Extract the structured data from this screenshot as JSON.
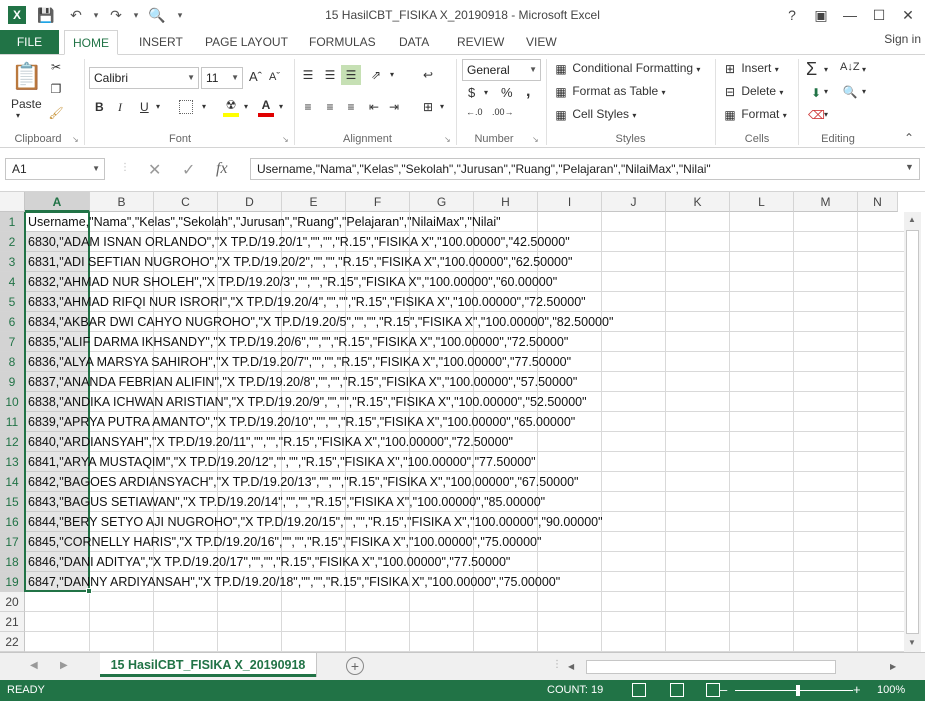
{
  "window": {
    "title": "15 HasilCBT_FISIKA X_20190918 - Microsoft Excel",
    "app_icon": "excel-x-icon",
    "help": "?",
    "controls": [
      "restore-ribbon-icon",
      "minimize-icon",
      "maximize-icon",
      "close-icon"
    ]
  },
  "ribbon_tabs": {
    "file": "FILE",
    "tabs": [
      "HOME",
      "INSERT",
      "PAGE LAYOUT",
      "FORMULAS",
      "DATA",
      "REVIEW",
      "VIEW"
    ],
    "active": "HOME",
    "signin": "Sign in"
  },
  "ribbon": {
    "clipboard": {
      "paste": "Paste",
      "label": "Clipboard"
    },
    "font": {
      "name": "Calibri",
      "size": "11",
      "label": "Font",
      "bold": "B",
      "italic": "I",
      "underline": "U"
    },
    "alignment": {
      "label": "Alignment"
    },
    "number": {
      "format": "General",
      "currency": "$",
      "percent": "%",
      "comma": ",",
      "label": "Number"
    },
    "styles": {
      "conditional": "Conditional Formatting",
      "format_table": "Format as Table",
      "cell_styles": "Cell Styles",
      "label": "Styles"
    },
    "cells": {
      "insert": "Insert",
      "delete": "Delete",
      "format": "Format",
      "label": "Cells"
    },
    "editing": {
      "label": "Editing"
    }
  },
  "formula_bar": {
    "name_box": "A1",
    "fx": "fx",
    "content": "Username,\"Nama\",\"Kelas\",\"Sekolah\",\"Jurusan\",\"Ruang\",\"Pelajaran\",\"NilaiMax\",\"Nilai\""
  },
  "grid": {
    "columns": [
      "A",
      "B",
      "C",
      "D",
      "E",
      "F",
      "G",
      "H",
      "I",
      "J",
      "K",
      "L",
      "M",
      "N"
    ],
    "selected_column": "A",
    "row_numbers": [
      "1",
      "2",
      "3",
      "4",
      "5",
      "6",
      "7",
      "8",
      "9",
      "10",
      "11",
      "12",
      "13",
      "14",
      "15",
      "16",
      "17",
      "18",
      "19",
      "20",
      "21",
      "22"
    ],
    "rows": [
      "Username,\"Nama\",\"Kelas\",\"Sekolah\",\"Jurusan\",\"Ruang\",\"Pelajaran\",\"NilaiMax\",\"Nilai\"",
      "6830,\"ADAM ISNAN ORLANDO\",\"X TP.D/19.20/1\",\"\",\"\",\"R.15\",\"FISIKA X\",\"100.00000\",\"42.50000\"",
      "6831,\"ADI SEFTIAN NUGROHO\",\"X TP.D/19.20/2\",\"\",\"\",\"R.15\",\"FISIKA X\",\"100.00000\",\"62.50000\"",
      "6832,\"AHMAD NUR SHOLEH\",\"X TP.D/19.20/3\",\"\",\"\",\"R.15\",\"FISIKA X\",\"100.00000\",\"60.00000\"",
      "6833,\"AHMAD RIFQI NUR ISRORI\",\"X TP.D/19.20/4\",\"\",\"\",\"R.15\",\"FISIKA X\",\"100.00000\",\"72.50000\"",
      "6834,\"AKBAR DWI CAHYO NUGROHO\",\"X TP.D/19.20/5\",\"\",\"\",\"R.15\",\"FISIKA X\",\"100.00000\",\"82.50000\"",
      "6835,\"ALIF DARMA IKHSANDY\",\"X TP.D/19.20/6\",\"\",\"\",\"R.15\",\"FISIKA X\",\"100.00000\",\"72.50000\"",
      "6836,\"ALYA MARSYA SAHIROH\",\"X TP.D/19.20/7\",\"\",\"\",\"R.15\",\"FISIKA X\",\"100.00000\",\"77.50000\"",
      "6837,\"ANANDA FEBRIAN ALIFIN\",\"X TP.D/19.20/8\",\"\",\"\",\"R.15\",\"FISIKA X\",\"100.00000\",\"57.50000\"",
      "6838,\"ANDIKA ICHWAN ARISTIAN\",\"X TP.D/19.20/9\",\"\",\"\",\"R.15\",\"FISIKA X\",\"100.00000\",\"52.50000\"",
      "6839,\"APRYA PUTRA AMANTO\",\"X TP.D/19.20/10\",\"\",\"\",\"R.15\",\"FISIKA X\",\"100.00000\",\"65.00000\"",
      "6840,\"ARDIANSYAH\",\"X TP.D/19.20/11\",\"\",\"\",\"R.15\",\"FISIKA X\",\"100.00000\",\"72.50000\"",
      "6841,\"ARYA MUSTAQIM\",\"X TP.D/19.20/12\",\"\",\"\",\"R.15\",\"FISIKA X\",\"100.00000\",\"77.50000\"",
      "6842,\"BAGOES ARDIANSYACH\",\"X TP.D/19.20/13\",\"\",\"\",\"R.15\",\"FISIKA X\",\"100.00000\",\"67.50000\"",
      "6843,\"BAGUS SETIAWAN\",\"X TP.D/19.20/14\",\"\",\"\",\"R.15\",\"FISIKA X\",\"100.00000\",\"85.00000\"",
      "6844,\"BERY SETYO AJI NUGROHO\",\"X TP.D/19.20/15\",\"\",\"\",\"R.15\",\"FISIKA X\",\"100.00000\",\"90.00000\"",
      "6845,\"CORNELLY HARIS\",\"X TP.D/19.20/16\",\"\",\"\",\"R.15\",\"FISIKA X\",\"100.00000\",\"75.00000\"",
      "6846,\"DANI ADITYA\",\"X TP.D/19.20/17\",\"\",\"\",\"R.15\",\"FISIKA X\",\"100.00000\",\"77.50000\"",
      "6847,\"DANNY ARDIYANSAH\",\"X TP.D/19.20/18\",\"\",\"\",\"R.15\",\"FISIKA X\",\"100.00000\",\"75.00000\""
    ]
  },
  "sheets": {
    "active": "15 HasilCBT_FISIKA X_20190918"
  },
  "status": {
    "ready": "READY",
    "count": "COUNT: 19",
    "zoom": "100%"
  },
  "colors": {
    "accent": "#217346",
    "selection": "#d3d3d3"
  }
}
